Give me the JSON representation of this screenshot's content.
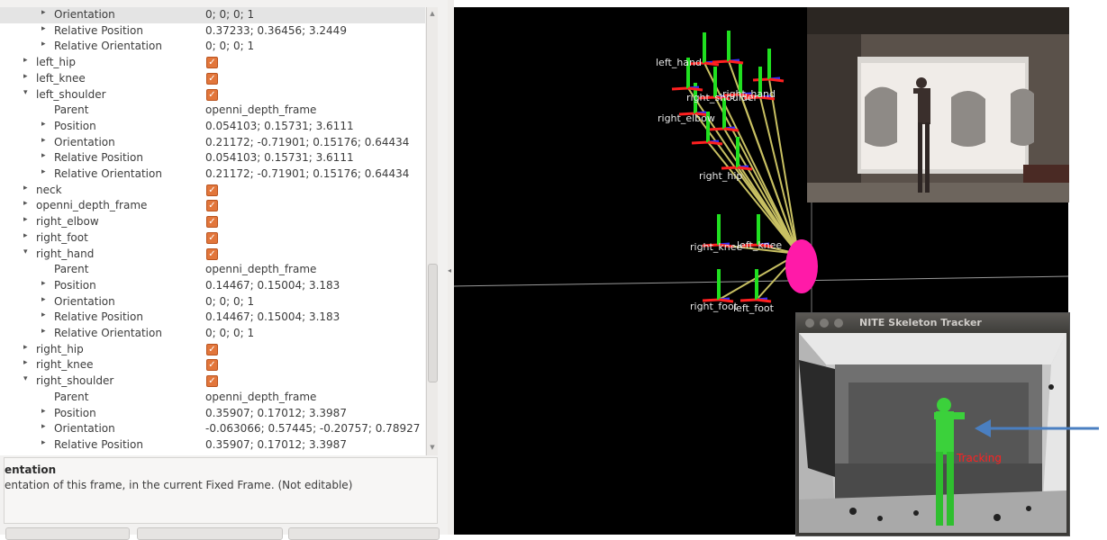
{
  "tree_rows": [
    {
      "indent": 2,
      "arrow": "▸",
      "name": "Orientation",
      "value": "0; 0; 0; 1",
      "selected": true
    },
    {
      "indent": 2,
      "arrow": "▸",
      "name": "Relative Position",
      "value": "0.37233; 0.36456; 3.2449"
    },
    {
      "indent": 2,
      "arrow": "▸",
      "name": "Relative Orientation",
      "value": "0; 0; 0; 1"
    },
    {
      "indent": 1,
      "arrow": "▸",
      "name": "left_hip",
      "checked": true
    },
    {
      "indent": 1,
      "arrow": "▸",
      "name": "left_knee",
      "checked": true
    },
    {
      "indent": 1,
      "arrow": "▾",
      "name": "left_shoulder",
      "checked": true
    },
    {
      "indent": 2,
      "arrow": "",
      "name": "Parent",
      "value": "openni_depth_frame"
    },
    {
      "indent": 2,
      "arrow": "▸",
      "name": "Position",
      "value": "0.054103; 0.15731; 3.6111"
    },
    {
      "indent": 2,
      "arrow": "▸",
      "name": "Orientation",
      "value": "0.21172; -0.71901; 0.15176; 0.64434"
    },
    {
      "indent": 2,
      "arrow": "▸",
      "name": "Relative Position",
      "value": "0.054103; 0.15731; 3.6111"
    },
    {
      "indent": 2,
      "arrow": "▸",
      "name": "Relative Orientation",
      "value": "0.21172; -0.71901; 0.15176; 0.64434"
    },
    {
      "indent": 1,
      "arrow": "▸",
      "name": "neck",
      "checked": true
    },
    {
      "indent": 1,
      "arrow": "▸",
      "name": "openni_depth_frame",
      "checked": true
    },
    {
      "indent": 1,
      "arrow": "▸",
      "name": "right_elbow",
      "checked": true
    },
    {
      "indent": 1,
      "arrow": "▸",
      "name": "right_foot",
      "checked": true
    },
    {
      "indent": 1,
      "arrow": "▾",
      "name": "right_hand",
      "checked": true
    },
    {
      "indent": 2,
      "arrow": "",
      "name": "Parent",
      "value": "openni_depth_frame"
    },
    {
      "indent": 2,
      "arrow": "▸",
      "name": "Position",
      "value": "0.14467; 0.15004; 3.183"
    },
    {
      "indent": 2,
      "arrow": "▸",
      "name": "Orientation",
      "value": "0; 0; 0; 1"
    },
    {
      "indent": 2,
      "arrow": "▸",
      "name": "Relative Position",
      "value": "0.14467; 0.15004; 3.183"
    },
    {
      "indent": 2,
      "arrow": "▸",
      "name": "Relative Orientation",
      "value": "0; 0; 0; 1"
    },
    {
      "indent": 1,
      "arrow": "▸",
      "name": "right_hip",
      "checked": true
    },
    {
      "indent": 1,
      "arrow": "▸",
      "name": "right_knee",
      "checked": true
    },
    {
      "indent": 1,
      "arrow": "▾",
      "name": "right_shoulder",
      "checked": true
    },
    {
      "indent": 2,
      "arrow": "",
      "name": "Parent",
      "value": "openni_depth_frame"
    },
    {
      "indent": 2,
      "arrow": "▸",
      "name": "Position",
      "value": "0.35907; 0.17012; 3.3987"
    },
    {
      "indent": 2,
      "arrow": "▸",
      "name": "Orientation",
      "value": "-0.063066; 0.57445; -0.20757; 0.78927"
    },
    {
      "indent": 2,
      "arrow": "▸",
      "name": "Relative Position",
      "value": "0.35907; 0.17012; 3.3987"
    }
  ],
  "description": {
    "title": "entation",
    "text": "entation of this frame, in the current Fixed Frame. (Not editable)"
  },
  "frame_labels": [
    "left_hand",
    "right_shoulder",
    "right_hand",
    "right_elbow",
    "right_hip",
    "right_knee",
    "left_knee",
    "right_foot",
    "left_foot"
  ],
  "nite_window": {
    "title": "NITE Skeleton Tracker",
    "status": "Tracking"
  },
  "colors": {
    "checkbox": "#e2763b",
    "axis_x": "#ff2020",
    "axis_y": "#20e020",
    "axis_z": "#3030ff",
    "tf_link": "#c8c062",
    "sensor_marker": "#ff1aa8",
    "annotation_arrow": "#4a7fc1",
    "tracking_text": "#ff2020"
  }
}
